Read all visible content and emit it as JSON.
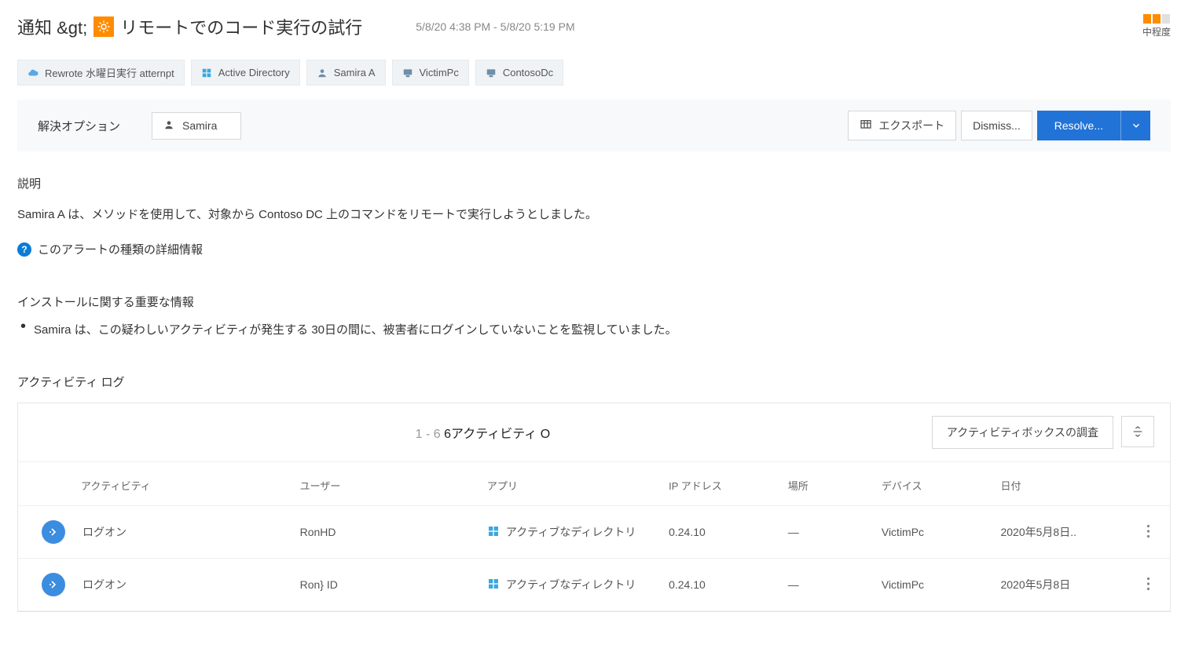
{
  "header": {
    "breadcrumb_prefix": "通知 &gt;",
    "title": "リモートでのコード実行の試行",
    "date_range": "5/8/20 4:38 PM - 5/8/20 5:19 PM"
  },
  "severity": {
    "label": "中程度",
    "filled": 2,
    "total": 3
  },
  "chips": [
    {
      "icon": "cloud",
      "label": "Rewrote 水曜日実行 atternpt"
    },
    {
      "icon": "windows",
      "label": "Active Directory"
    },
    {
      "icon": "user",
      "label": "Samira A"
    },
    {
      "icon": "device",
      "label": "VictimPc"
    },
    {
      "icon": "device",
      "label": "ContosoDc"
    }
  ],
  "toolbar": {
    "label": "解決オプション",
    "user": "Samira",
    "export": "エクスポート",
    "dismiss": "Dismiss...",
    "resolve": "Resolve..."
  },
  "description": {
    "label": "説明",
    "text": "Samira A は、メソッドを使用して、対象から Contoso DC 上のコマンドをリモートで実行しようとしました。",
    "more_info": "このアラートの種類の詳細情報"
  },
  "important": {
    "title": "インストールに関する重要な情報",
    "items": [
      "Samira は、この疑わしいアクティビティが発生する 30日の間に、被害者にログインしていないことを監視していました。"
    ]
  },
  "activity_log": {
    "title": "アクティビティ ログ",
    "count_prefix": "1 - 6",
    "count_main": "6アクティビティ O",
    "investigate": "アクティビティボックスの調査",
    "columns": {
      "activity": "アクティビティ",
      "user": "ユーザー",
      "app": "アプリ",
      "ip": "IP アドレス",
      "location": "場所",
      "device": "デバイス",
      "date": "日付"
    },
    "rows": [
      {
        "activity": "ログオン",
        "user": "RonHD",
        "app": "アクティブなディレクトリ",
        "ip": "0.24.10",
        "location": "—",
        "device": "VictimPc",
        "date": "2020年5月8日.."
      },
      {
        "activity": "ログオン",
        "user": "Ron} ID",
        "app": "アクティブなディレクトリ",
        "ip": "0.24.10",
        "location": "—",
        "device": "VictimPc",
        "date": "2020年5月8日"
      }
    ]
  }
}
